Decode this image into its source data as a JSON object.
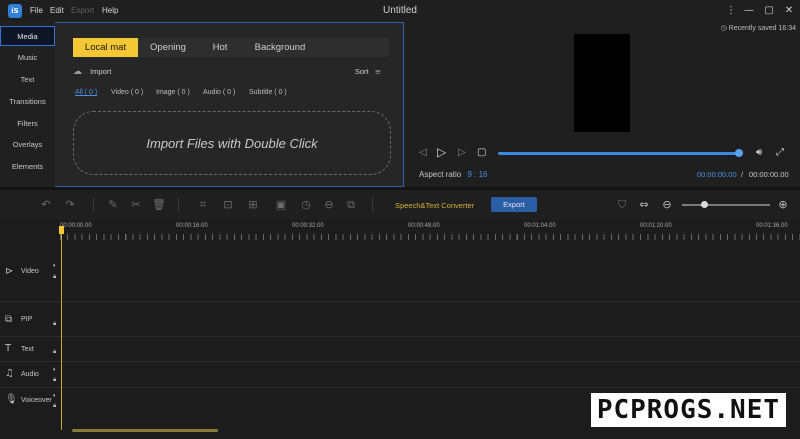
{
  "titlebar": {
    "logo_text": "iS",
    "menu": [
      "File",
      "Edit",
      "Export",
      "Help"
    ],
    "title": "Untitled",
    "controls": {
      "more": "⋮",
      "minimize": "—",
      "maximize": "▢",
      "close": "✕"
    }
  },
  "media_panel": {
    "side_tabs": [
      "Media",
      "Music",
      "Text",
      "Transitions",
      "Filters",
      "Overlays",
      "Elements"
    ],
    "active_side_tab": "Media",
    "content_tabs": [
      "Local mat",
      "Opening",
      "Hot",
      "Background"
    ],
    "active_content_tab": "Local mat",
    "import_label": "Import",
    "sort_label": "Sort",
    "filters": [
      "All ( 0 )",
      "Video ( 0 )",
      "Image ( 0 )",
      "Audio ( 0 )",
      "Subtitle ( 0 )"
    ],
    "dropzone_text": "Import Files with Double Click"
  },
  "preview": {
    "saved_note": "Recently saved 16:34",
    "aspect_label": "Aspect ratio",
    "aspect_value": "9 : 16",
    "current_time": "00:00:00.00",
    "time_separator": "/",
    "total_time": "00:00:00.00"
  },
  "toolbar": {
    "speech_label": "Speech&Text Converter",
    "export_label": "Export",
    "zoom_level": 0.25
  },
  "timeline": {
    "ruler_labels": [
      "00:00:00.00",
      "00:00:16.00",
      "00:00:32.00",
      "00:00:48.00",
      "00:01:04.00",
      "00:01:20.00",
      "00:01:36.00"
    ],
    "tracks": [
      "Video",
      "PIP",
      "Text",
      "Audio",
      "Voiceover"
    ]
  },
  "watermark": "PCPROGS.NET",
  "colors": {
    "accent_yellow": "#f4c834",
    "accent_blue": "#3a8be0",
    "export_button": "#2a5fa8"
  }
}
